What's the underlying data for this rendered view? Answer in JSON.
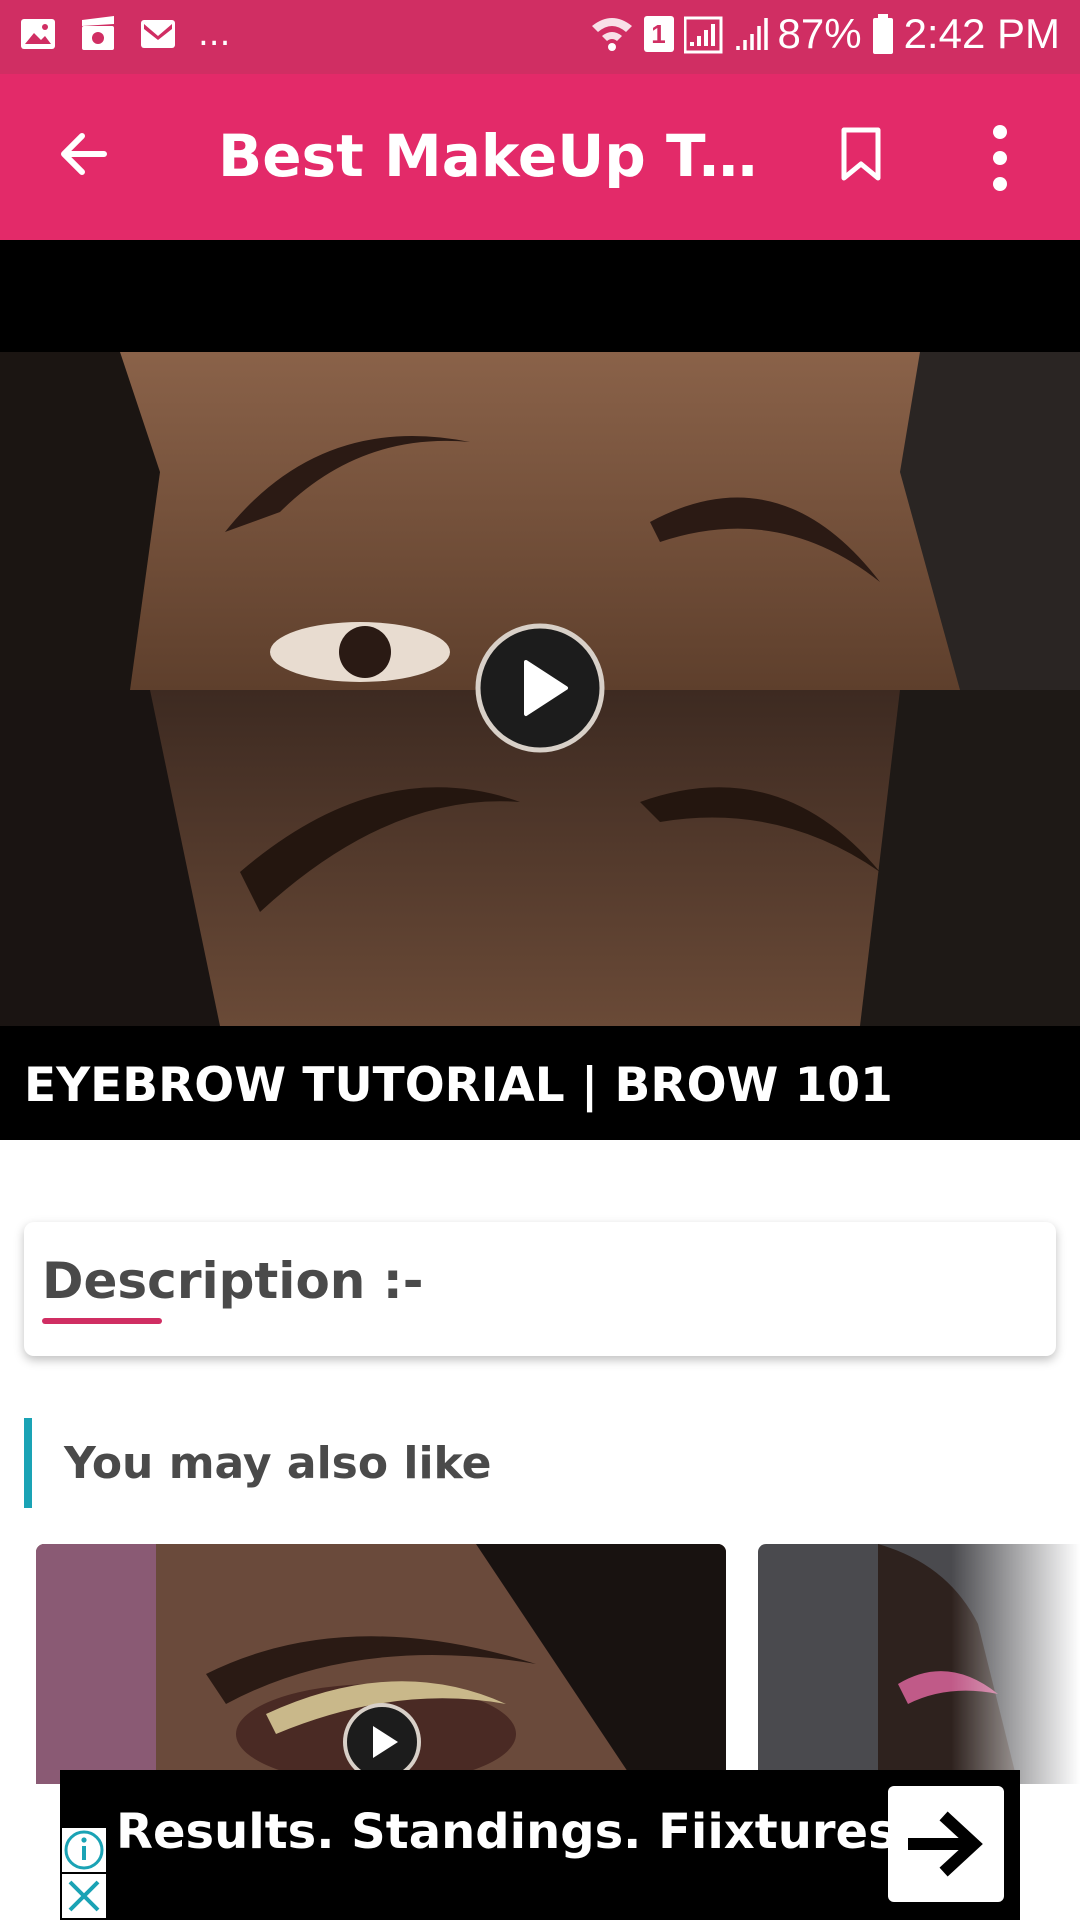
{
  "status_bar": {
    "notification_icons": [
      "image-icon",
      "video-icon",
      "gmail-icon"
    ],
    "overflow": "...",
    "sim_slot": "1",
    "battery": "87%",
    "time": "2:42 PM"
  },
  "app_bar": {
    "title": "Best MakeUp Tu...",
    "icons": [
      "back-arrow-icon",
      "bookmark-icon",
      "more-vert-icon"
    ]
  },
  "video": {
    "title": "EYEBROW TUTORIAL | BROW 101"
  },
  "description": {
    "label": "Description :-"
  },
  "related": {
    "heading": "You may also like"
  },
  "ad": {
    "text": "Results. Standings. Fiixtures"
  },
  "colors": {
    "status_bar": "#d02e63",
    "app_bar": "#e32a69",
    "accent_underline": "#d02e63",
    "section_bar": "#1aa3b5"
  }
}
